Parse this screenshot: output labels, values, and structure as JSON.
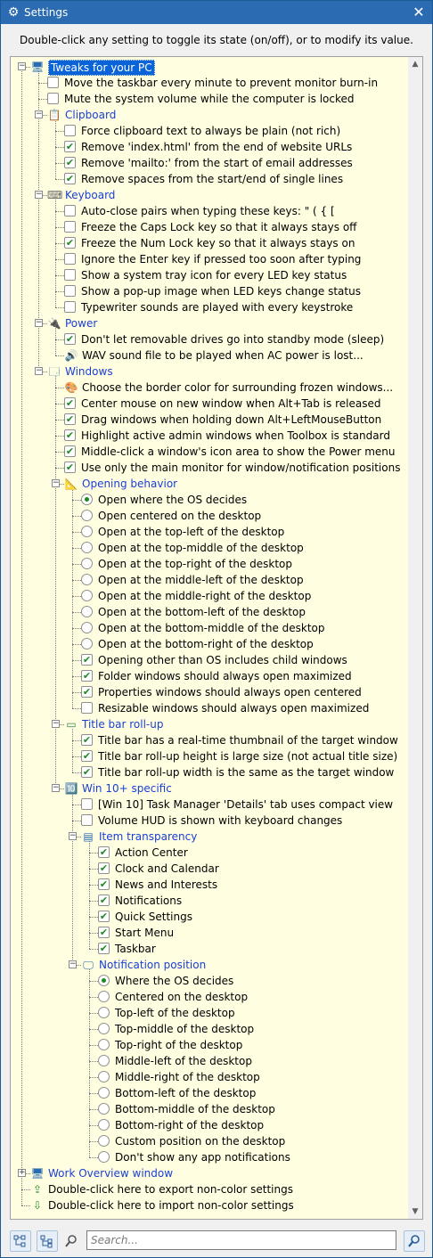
{
  "window": {
    "title": "Settings",
    "gear_icon": "⚙",
    "close_glyph": "✕"
  },
  "hint": "Double-click any setting to toggle its state (on/off), or to modify its value.",
  "tree": [
    {
      "level": 0,
      "kind": "cat",
      "label": "Tweaks for your PC",
      "icon": "pc",
      "selected": true,
      "expander": "−"
    },
    {
      "level": 1,
      "kind": "check",
      "checked": false,
      "label": "Move the taskbar every minute to prevent monitor burn-in"
    },
    {
      "level": 1,
      "kind": "check",
      "checked": false,
      "label": "Mute the system volume while the computer is locked"
    },
    {
      "level": 1,
      "kind": "cat",
      "label": "Clipboard",
      "icon": "clipboard",
      "expander": "−"
    },
    {
      "level": 2,
      "kind": "check",
      "checked": false,
      "label": "Force clipboard text to always be plain (not rich)"
    },
    {
      "level": 2,
      "kind": "check",
      "checked": true,
      "label": "Remove 'index.html' from the end of website URLs"
    },
    {
      "level": 2,
      "kind": "check",
      "checked": true,
      "label": "Remove 'mailto:' from the start of email addresses"
    },
    {
      "level": 2,
      "kind": "check",
      "checked": true,
      "label": "Remove spaces from the start/end of single lines"
    },
    {
      "level": 1,
      "kind": "cat",
      "label": "Keyboard",
      "icon": "keyboard",
      "expander": "−"
    },
    {
      "level": 2,
      "kind": "check",
      "checked": false,
      "label": "Auto-close pairs when typing these keys:  \"   (   {   ["
    },
    {
      "level": 2,
      "kind": "check",
      "checked": false,
      "label": "Freeze the Caps Lock key so that it always stays off"
    },
    {
      "level": 2,
      "kind": "check",
      "checked": true,
      "label": "Freeze the Num Lock key so that it always stays on"
    },
    {
      "level": 2,
      "kind": "check",
      "checked": false,
      "label": "Ignore the Enter key if pressed too soon after typing"
    },
    {
      "level": 2,
      "kind": "check",
      "checked": false,
      "label": "Show a system tray icon for every LED key status"
    },
    {
      "level": 2,
      "kind": "check",
      "checked": false,
      "label": "Show a pop-up image when LED keys change status"
    },
    {
      "level": 2,
      "kind": "check",
      "checked": false,
      "label": "Typewriter sounds are played with every keystroke"
    },
    {
      "level": 1,
      "kind": "cat",
      "label": "Power",
      "icon": "plug",
      "expander": "−"
    },
    {
      "level": 2,
      "kind": "check",
      "checked": true,
      "label": "Don't let removable drives go into standby mode (sleep)"
    },
    {
      "level": 2,
      "kind": "action",
      "icon": "sound",
      "label": "WAV sound file to be played when AC power is lost..."
    },
    {
      "level": 1,
      "kind": "cat",
      "label": "Windows",
      "icon": "windows",
      "expander": "−"
    },
    {
      "level": 2,
      "kind": "action",
      "icon": "color",
      "label": "Choose the border color for surrounding frozen windows..."
    },
    {
      "level": 2,
      "kind": "check",
      "checked": true,
      "label": "Center mouse on new window when Alt+Tab is released"
    },
    {
      "level": 2,
      "kind": "check",
      "checked": true,
      "label": "Drag windows when holding down Alt+LeftMouseButton"
    },
    {
      "level": 2,
      "kind": "check",
      "checked": true,
      "label": "Highlight active admin windows when Toolbox is standard"
    },
    {
      "level": 2,
      "kind": "check",
      "checked": true,
      "label": "Middle-click a window's icon area to show the Power menu"
    },
    {
      "level": 2,
      "kind": "check",
      "checked": true,
      "label": "Use only the main monitor for window/notification positions"
    },
    {
      "level": 2,
      "kind": "cat",
      "label": "Opening behavior",
      "icon": "opening",
      "expander": "−"
    },
    {
      "level": 3,
      "kind": "radio",
      "checked": true,
      "label": "Open where the OS decides"
    },
    {
      "level": 3,
      "kind": "radio",
      "checked": false,
      "label": "Open centered on the desktop"
    },
    {
      "level": 3,
      "kind": "radio",
      "checked": false,
      "label": "Open at the top-left of the desktop"
    },
    {
      "level": 3,
      "kind": "radio",
      "checked": false,
      "label": "Open at the top-middle of the desktop"
    },
    {
      "level": 3,
      "kind": "radio",
      "checked": false,
      "label": "Open at the top-right of the desktop"
    },
    {
      "level": 3,
      "kind": "radio",
      "checked": false,
      "label": "Open at the middle-left of the desktop"
    },
    {
      "level": 3,
      "kind": "radio",
      "checked": false,
      "label": "Open at the middle-right of the desktop"
    },
    {
      "level": 3,
      "kind": "radio",
      "checked": false,
      "label": "Open at the bottom-left of the desktop"
    },
    {
      "level": 3,
      "kind": "radio",
      "checked": false,
      "label": "Open at the bottom-middle of the desktop"
    },
    {
      "level": 3,
      "kind": "radio",
      "checked": false,
      "label": "Open at the bottom-right of the desktop"
    },
    {
      "level": 3,
      "kind": "check",
      "checked": true,
      "label": "Opening other than OS includes child windows"
    },
    {
      "level": 3,
      "kind": "check",
      "checked": true,
      "label": "Folder windows should always open maximized"
    },
    {
      "level": 3,
      "kind": "check",
      "checked": true,
      "label": "Properties windows should always open centered"
    },
    {
      "level": 3,
      "kind": "check",
      "checked": false,
      "label": "Resizable windows should always open maximized"
    },
    {
      "level": 2,
      "kind": "cat",
      "label": "Title bar roll-up",
      "icon": "titlebar",
      "expander": "−"
    },
    {
      "level": 3,
      "kind": "check",
      "checked": true,
      "label": "Title bar has a real-time thumbnail of the target window"
    },
    {
      "level": 3,
      "kind": "check",
      "checked": true,
      "label": "Title bar roll-up height is large size (not actual title size)"
    },
    {
      "level": 3,
      "kind": "check",
      "checked": true,
      "label": "Title bar roll-up width is the same as the target window"
    },
    {
      "level": 2,
      "kind": "cat",
      "label": "Win 10+ specific",
      "icon": "win10",
      "expander": "−"
    },
    {
      "level": 3,
      "kind": "check",
      "checked": false,
      "label": "[Win 10] Task Manager 'Details' tab uses compact view"
    },
    {
      "level": 3,
      "kind": "check",
      "checked": false,
      "label": "Volume HUD is shown with keyboard changes"
    },
    {
      "level": 3,
      "kind": "cat",
      "label": "Item transparency",
      "icon": "transparency",
      "expander": "−"
    },
    {
      "level": 4,
      "kind": "check",
      "checked": true,
      "label": "Action Center"
    },
    {
      "level": 4,
      "kind": "check",
      "checked": true,
      "label": "Clock and Calendar"
    },
    {
      "level": 4,
      "kind": "check",
      "checked": true,
      "label": "News and Interests"
    },
    {
      "level": 4,
      "kind": "check",
      "checked": true,
      "label": "Notifications"
    },
    {
      "level": 4,
      "kind": "check",
      "checked": true,
      "label": "Quick Settings"
    },
    {
      "level": 4,
      "kind": "check",
      "checked": true,
      "label": "Start Menu"
    },
    {
      "level": 4,
      "kind": "check",
      "checked": true,
      "label": "Taskbar"
    },
    {
      "level": 3,
      "kind": "cat",
      "label": "Notification position",
      "icon": "notification",
      "expander": "−"
    },
    {
      "level": 4,
      "kind": "radio",
      "checked": true,
      "label": "Where the OS decides"
    },
    {
      "level": 4,
      "kind": "radio",
      "checked": false,
      "label": "Centered on the desktop"
    },
    {
      "level": 4,
      "kind": "radio",
      "checked": false,
      "label": "Top-left of the desktop"
    },
    {
      "level": 4,
      "kind": "radio",
      "checked": false,
      "label": "Top-middle of the desktop"
    },
    {
      "level": 4,
      "kind": "radio",
      "checked": false,
      "label": "Top-right of the desktop"
    },
    {
      "level": 4,
      "kind": "radio",
      "checked": false,
      "label": "Middle-left of the desktop"
    },
    {
      "level": 4,
      "kind": "radio",
      "checked": false,
      "label": "Middle-right of the desktop"
    },
    {
      "level": 4,
      "kind": "radio",
      "checked": false,
      "label": "Bottom-left of the desktop"
    },
    {
      "level": 4,
      "kind": "radio",
      "checked": false,
      "label": "Bottom-middle of the desktop"
    },
    {
      "level": 4,
      "kind": "radio",
      "checked": false,
      "label": "Bottom-right of the desktop"
    },
    {
      "level": 4,
      "kind": "radio",
      "checked": false,
      "label": "Custom position on the desktop"
    },
    {
      "level": 4,
      "kind": "radio",
      "checked": false,
      "label": "Don't show any app notifications"
    },
    {
      "level": 0,
      "kind": "cat",
      "label": "Work Overview window",
      "icon": "monitor",
      "expander": "+"
    },
    {
      "level": 0,
      "kind": "plain",
      "label": "Double-click here to export non-color settings",
      "icon": "export"
    },
    {
      "level": 0,
      "kind": "plain",
      "label": "Double-click here to import non-color settings",
      "icon": "import"
    }
  ],
  "scrollbar": {
    "up": "▲",
    "down": "▼"
  },
  "bottom": {
    "expand_icon": "expand-tree-icon",
    "collapse_icon": "collapse-tree-icon",
    "search_placeholder": "Search...",
    "search_value": ""
  },
  "colors": {
    "category": "#1a3fd6",
    "selection": "#0a64d8",
    "tree_bg": "#fffee0",
    "titlebar": "#2a6bb1",
    "check": "#1c8a22"
  }
}
